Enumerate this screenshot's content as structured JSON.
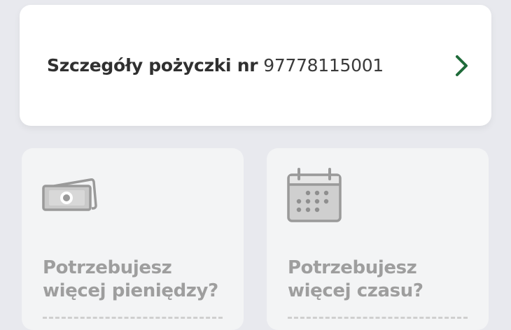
{
  "loan": {
    "label": "Szczegóły pożyczki nr",
    "number": "97778115001",
    "accent": "#1f6b3a"
  },
  "tiles": [
    {
      "icon": "money-icon",
      "line1": "Potrzebujesz",
      "line2": "więcej pieniędzy?"
    },
    {
      "icon": "calendar-icon",
      "line1": "Potrzebujesz",
      "line2": "więcej czasu?"
    }
  ],
  "colors": {
    "background": "#e8e9ee",
    "card": "#ffffff",
    "tile": "#f3f4f5",
    "muted_text": "#9e9e9e"
  }
}
